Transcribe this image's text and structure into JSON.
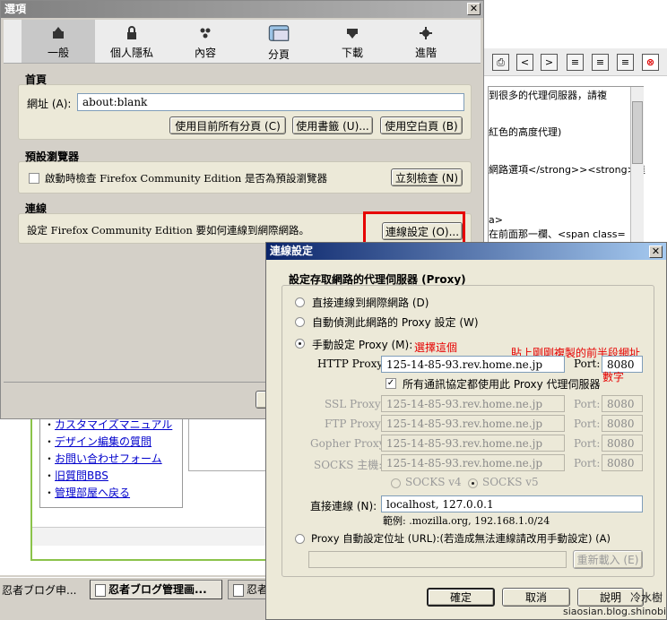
{
  "options": {
    "title": "選項",
    "tabs": [
      {
        "label": "一般",
        "icon": "general-icon",
        "active": true
      },
      {
        "label": "個人隱私",
        "icon": "privacy-icon"
      },
      {
        "label": "內容",
        "icon": "content-icon"
      },
      {
        "label": "分頁",
        "icon": "tabs-icon"
      },
      {
        "label": "下載",
        "icon": "downloads-icon"
      },
      {
        "label": "進階",
        "icon": "advanced-icon"
      }
    ],
    "home": {
      "title": "首頁",
      "url_label": "網址 (A):",
      "url_value": "about:blank",
      "btn_current": "使用目前所有分頁 (C)",
      "btn_bookmark": "使用書籤 (U)...",
      "btn_blank": "使用空白頁 (B)"
    },
    "default_browser": {
      "title": "預設瀏覽器",
      "check_label": "啟動時檢查 Firefox Community Edition 是否為預設瀏覽器",
      "btn_check": "立刻檢查 (N)"
    },
    "connection": {
      "title": "連線",
      "desc": "設定 Firefox Community Edition 要如何連線到網際網路。",
      "btn_settings": "連線設定 (O)..."
    }
  },
  "bg_page": {
    "text_lines": [
      "到很多的代理伺服器，請複",
      "紅色的高度代理)",
      "網路選項</strong>><strong>連",
      "a>",
      "在前面那一欄、<span class="
    ],
    "jp_links": [
      "カスタマイズマニュアル",
      "デザイン編集の質問",
      "お問い合わせフォーム",
      "旧質問BBS",
      "管理部屋へ戻る"
    ]
  },
  "taskbar": {
    "items": [
      "忍者ブログ申...",
      "忍者ブログ管理画...",
      "忍者"
    ]
  },
  "conn": {
    "title": "連線設定",
    "group_title": "設定存取網路的代理伺服器 (Proxy)",
    "radio_direct": "直接連線到網際網路 (D)",
    "radio_auto": "自動偵測此網路的 Proxy 設定 (W)",
    "radio_manual": "手動設定 Proxy (M):",
    "annotation_select": "選擇這個",
    "annotation_paste": "貼上剛剛複製的前半段網址",
    "annotation_number": "數字",
    "http_label": "HTTP Proxy:",
    "http_value": "125-14-85-93.rev.home.ne.jp",
    "port_label": "Port:",
    "http_port": "8080",
    "share_label": "所有通訊協定都使用此 Proxy 代理伺服器",
    "ssl_label": "SSL Proxy:",
    "ftp_label": "FTP Proxy:",
    "gopher_label": "Gopher Proxy:",
    "socks_label": "SOCKS 主機:",
    "proxy_value": "125-14-85-93.rev.home.ne.jp",
    "port_value": "8080",
    "socks_v4": "SOCKS v4",
    "socks_v5": "SOCKS v5",
    "no_proxy_label": "直接連線 (N):",
    "no_proxy_value": "localhost, 127.0.0.1",
    "example": "範例: .mozilla.org, 192.168.1.0/24",
    "radio_pac": "Proxy 自動設定位址 (URL):(若造成無法連線請改用手動設定) (A)",
    "btn_reload": "重新載入 (E)",
    "btn_ok": "確定",
    "btn_cancel": "取消",
    "btn_help": "說明"
  },
  "watermark": {
    "name": "冷水樹",
    "url": "siaosian.blog.shinobi.jp"
  }
}
